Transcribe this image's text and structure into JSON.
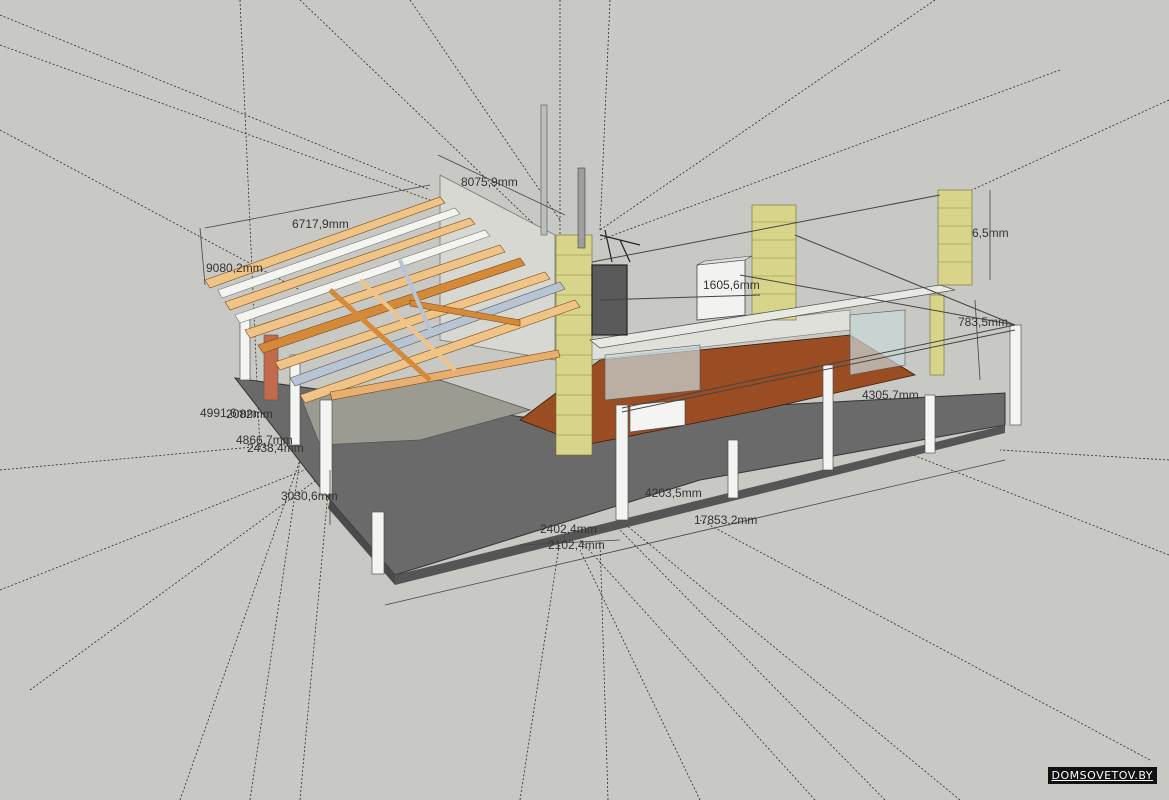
{
  "colors": {
    "background": "#c8c9c4",
    "deck": "#6a6a6a",
    "wood_floor": "#9a4d22",
    "log": "#d8d58a",
    "rafter_light": "#f0c487",
    "rafter_dark": "#d58a3a",
    "post": "#f4f4f2",
    "guide_line": "#2a2a2a"
  },
  "scene": {
    "description_icons": [
      "log-wall-icon",
      "chimney-icon",
      "post-icon",
      "rafter-icon"
    ]
  },
  "dimensions": {
    "d1": "8075,9mm",
    "d2": "6717,9mm",
    "d3": "9080,2mm",
    "d4": "1605,6mm",
    "d5": "6,5mm",
    "d6": "783,5mm",
    "d7": "4991,6mm",
    "d8": "2082mm",
    "d9": "4866,7mm",
    "d10": "2438,4mm",
    "d11": "3030,6mm",
    "d12": "2402,4mm",
    "d13": "2102,4mm",
    "d14": "17853,2mm",
    "d15": "4203,5mm",
    "d16": "4305,7mm"
  },
  "watermark": "DOMSOVETOV.BY"
}
